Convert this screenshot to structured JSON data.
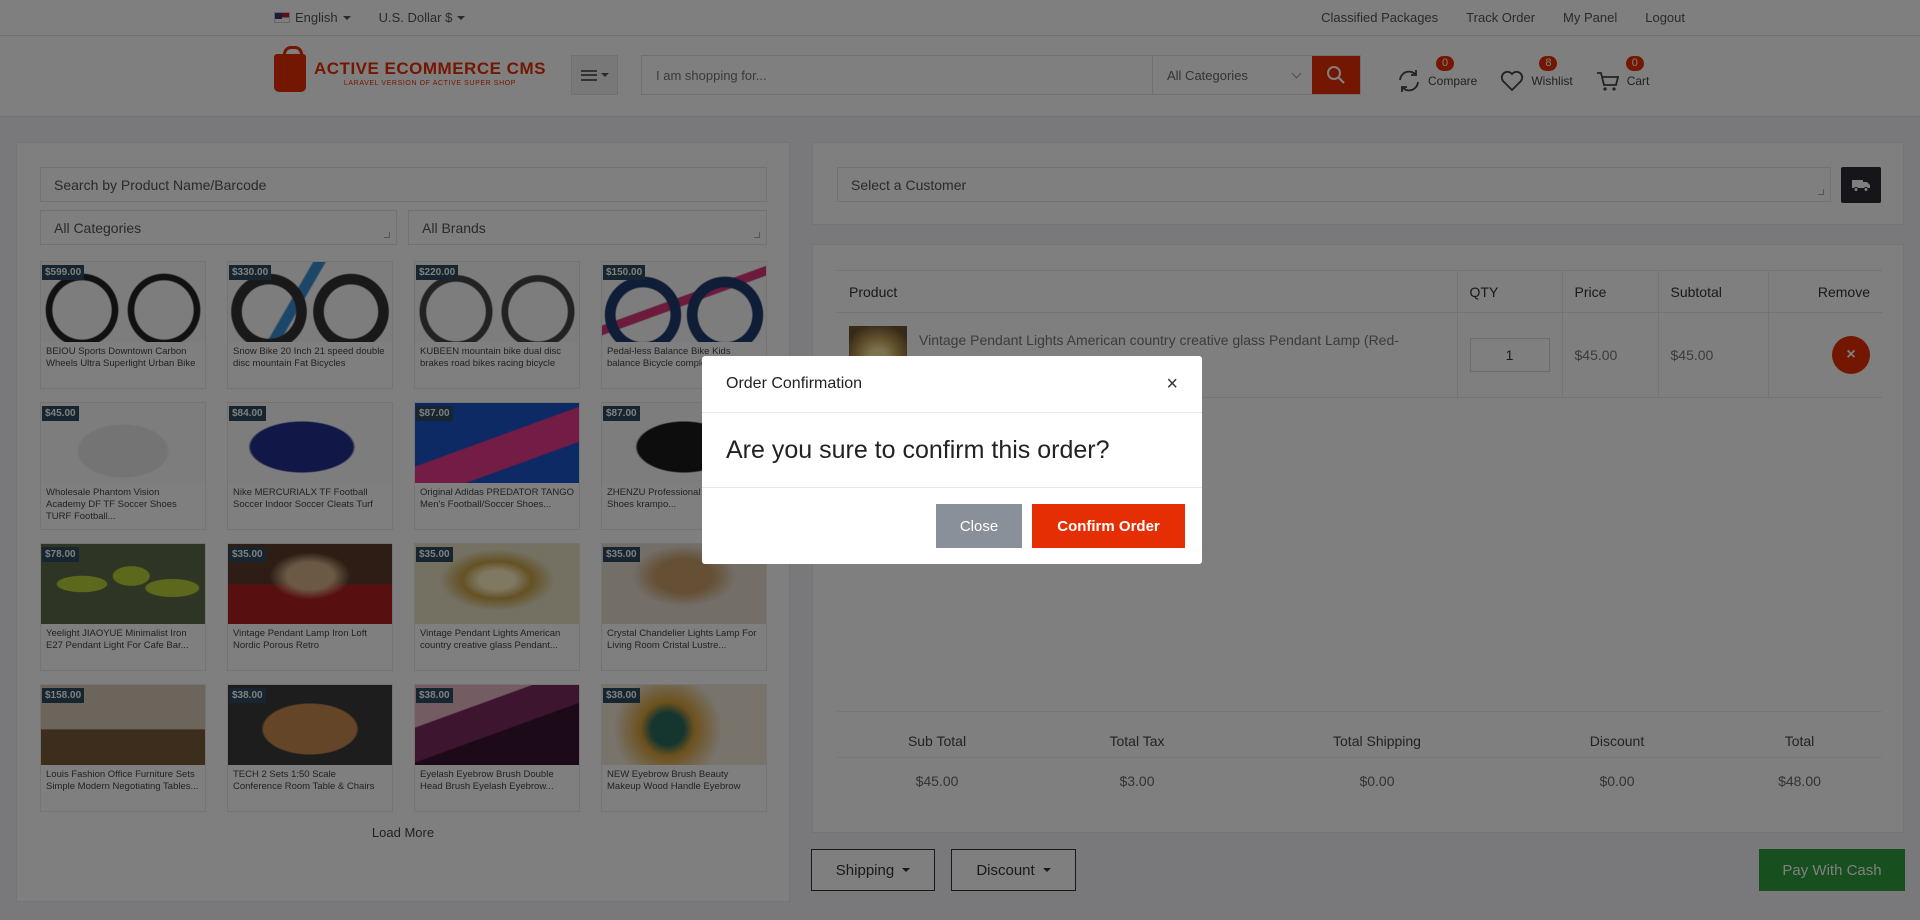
{
  "topbar": {
    "language": "English",
    "currency": "U.S. Dollar $",
    "links": [
      "Classified Packages",
      "Track Order",
      "My Panel",
      "Logout"
    ]
  },
  "header": {
    "logo_title": "ACTIVE ECOMMERCE CMS",
    "logo_subtitle": "LARAVEL VERSION OF ACTIVE SUPER SHOP",
    "search_placeholder": "I am shopping for...",
    "search_category": "All Categories",
    "compare": {
      "label": "Compare",
      "count": "0"
    },
    "wishlist": {
      "label": "Wishlist",
      "count": "8"
    },
    "cart": {
      "label": "Cart",
      "count": "0"
    }
  },
  "pos_left": {
    "product_search_placeholder": "Search by Product Name/Barcode",
    "category_filter": "All Categories",
    "brand_filter": "All Brands",
    "load_more": "Load More",
    "products": [
      {
        "price": "$599.00",
        "name": "BEIOU Sports Downtown Carbon Wheels Ultra Superlight Urban Bike"
      },
      {
        "price": "$330.00",
        "name": "Snow Bike 20 Inch 21 speed double disc mountain Fat Bicycles"
      },
      {
        "price": "$220.00",
        "name": "KUBEEN mountain bike dual disc brakes road bikes racing bicycle"
      },
      {
        "price": "$150.00",
        "name": "Pedal-less Balance Bike Kids balance Bicycle complete bike f..."
      },
      {
        "price": "$45.00",
        "name": "Wholesale Phantom Vision Academy DF TF Soccer Shoes TURF Football..."
      },
      {
        "price": "$84.00",
        "name": "Nike MERCURIALX TF Football Soccer Indoor Soccer Cleats Turf"
      },
      {
        "price": "$87.00",
        "name": "Original Adidas PREDATOR TANGO Men's Football/Soccer Shoes..."
      },
      {
        "price": "$87.00",
        "name": "ZHENZU Professional S... Football Shoes krampo..."
      },
      {
        "price": "$78.00",
        "name": "Yeelight JIAOYUE Minimalist Iron E27 Pendant Light For Cafe Bar..."
      },
      {
        "price": "$35.00",
        "name": "Vintage Pendant Lamp Iron Loft Nordic Porous Retro"
      },
      {
        "price": "$35.00",
        "name": "Vintage Pendant Lights American country creative glass Pendant..."
      },
      {
        "price": "$35.00",
        "name": "Crystal Chandelier Lights Lamp For Living Room Cristal Lustre..."
      },
      {
        "price": "$158.00",
        "name": "Louis Fashion Office Furniture Sets Simple Modern Negotiating Tables..."
      },
      {
        "price": "$38.00",
        "name": "TECH 2 Sets 1:50 Scale Conference Room Table & Chairs"
      },
      {
        "price": "$38.00",
        "name": "Eyelash Eyebrow Brush Double Head Brush Eyelash Eyebrow..."
      },
      {
        "price": "$38.00",
        "name": "NEW Eyebrow Brush Beauty Makeup Wood Handle Eyebrow"
      }
    ]
  },
  "pos_right": {
    "customer_placeholder": "Select a Customer",
    "table_headers": {
      "product": "Product",
      "qty": "QTY",
      "price": "Price",
      "subtotal": "Subtotal",
      "remove": "Remove"
    },
    "cart_item": {
      "name": "Vintage Pendant Lights American country creative glass Pendant Lamp (Red-",
      "qty": "1",
      "price": "$45.00",
      "subtotal": "$45.00"
    },
    "totals": {
      "labels": [
        "Sub Total",
        "Total Tax",
        "Total Shipping",
        "Discount",
        "Total"
      ],
      "values": [
        "$45.00",
        "$3.00",
        "$0.00",
        "$0.00",
        "$48.00"
      ]
    },
    "shipping_btn": "Shipping",
    "discount_btn": "Discount",
    "pay_btn": "Pay With Cash"
  },
  "modal": {
    "title": "Order Confirmation",
    "close_glyph": "×",
    "message": "Are you sure to confirm this order?",
    "close_btn": "Close",
    "confirm_btn": "Confirm Order"
  },
  "colors": {
    "accent": "#e62e04",
    "pay": "#2e9e3d",
    "price_tag": "#2c4a5f"
  },
  "thumb_styles": [
    "bike-black",
    "bike-blue",
    "bike-ebike",
    "bike-pink",
    "shoe-white",
    "shoe-navy",
    "shoe-blue-pink",
    "shoe-black",
    "lamp-green",
    "chandelier-red",
    "chandelier-gold",
    "chandelier-crystal",
    "office-room",
    "conference-table",
    "eye-purple",
    "eye-feather"
  ]
}
